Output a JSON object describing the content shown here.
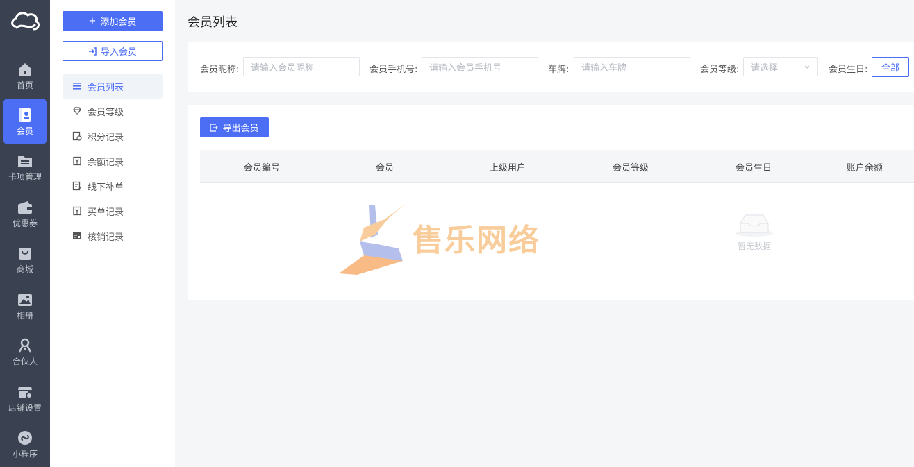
{
  "rail": {
    "items": [
      {
        "label": "首页",
        "icon": "home-icon"
      },
      {
        "label": "会员",
        "icon": "member-card-icon",
        "active": true
      },
      {
        "label": "卡项管理",
        "icon": "card-folder-icon"
      },
      {
        "label": "优惠券",
        "icon": "wallet-icon"
      },
      {
        "label": "商城",
        "icon": "shopping-bag-icon"
      },
      {
        "label": "相册",
        "icon": "photo-icon"
      },
      {
        "label": "合伙人",
        "icon": "partner-icon"
      },
      {
        "label": "店铺设置",
        "icon": "store-settings-icon"
      },
      {
        "label": "小程序",
        "icon": "mini-program-icon"
      }
    ]
  },
  "subnav": {
    "add_label": "添加会员",
    "import_label": "导入会员",
    "items": [
      {
        "label": "会员列表",
        "active": true
      },
      {
        "label": "会员等级"
      },
      {
        "label": "积分记录"
      },
      {
        "label": "余额记录"
      },
      {
        "label": "线下补单"
      },
      {
        "label": "买单记录"
      },
      {
        "label": "核销记录"
      }
    ]
  },
  "page": {
    "title": "会员列表"
  },
  "filters": {
    "nickname_label": "会员昵称:",
    "nickname_placeholder": "请输入会员昵称",
    "phone_label": "会员手机号:",
    "phone_placeholder": "请输入会员手机号",
    "plate_label": "车牌:",
    "plate_placeholder": "请输入车牌",
    "level_label": "会员等级:",
    "level_value": "请选择",
    "birthday_label": "会员生日:",
    "birthday_all": "全部"
  },
  "table": {
    "export_label": "导出会员",
    "columns": [
      "会员编号",
      "会员",
      "上级用户",
      "会员等级",
      "会员生日",
      "账户余额"
    ],
    "empty_text": "暂无数据"
  },
  "watermark": {
    "text": "售乐网络"
  },
  "colors": {
    "primary": "#4c6ef5",
    "rail_bg": "#3a4150"
  }
}
